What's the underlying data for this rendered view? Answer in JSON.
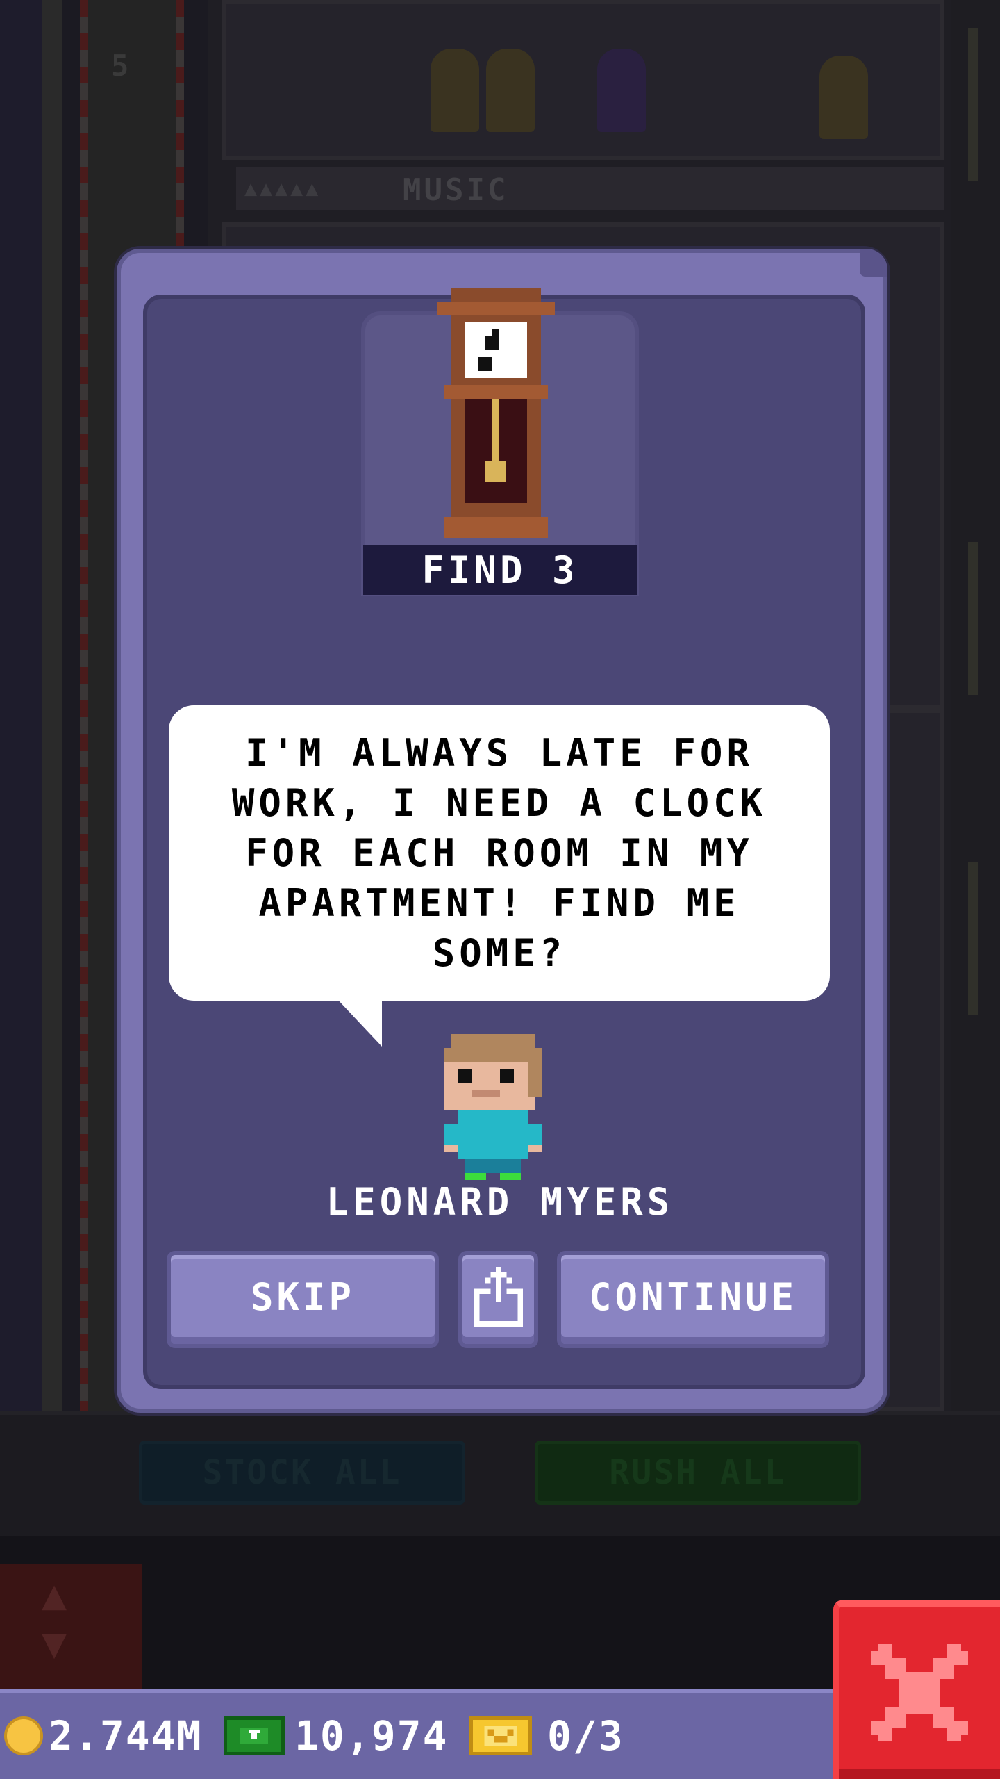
{
  "background": {
    "floor_number": "5",
    "room_name": "MUSIC",
    "room_rating_dots": "▲▲▲▲▲",
    "stock_all_label": "STOCK ALL",
    "rush_all_label": "RUSH ALL"
  },
  "mission": {
    "item_icon": "grandfather-clock-icon",
    "objective": "FIND 3",
    "speech": "I'M ALWAYS LATE FOR WORK, I NEED A CLOCK FOR EACH ROOM IN MY APARTMENT! FIND ME SOME?",
    "character_name": "LEONARD MYERS"
  },
  "buttons": {
    "skip_label": "SKIP",
    "share_icon": "share-icon",
    "continue_label": "CONTINUE"
  },
  "currency": {
    "coins": "2.744M",
    "bux": "10,974",
    "tickets": "0/3"
  },
  "colors": {
    "card": "#7b74b1",
    "card_inner": "#4b4776",
    "button": "#8a84c2",
    "close_button": "#e3262f",
    "coin": "#f7c442",
    "bux": "#1e8b27",
    "ticket": "#f6c72f"
  }
}
